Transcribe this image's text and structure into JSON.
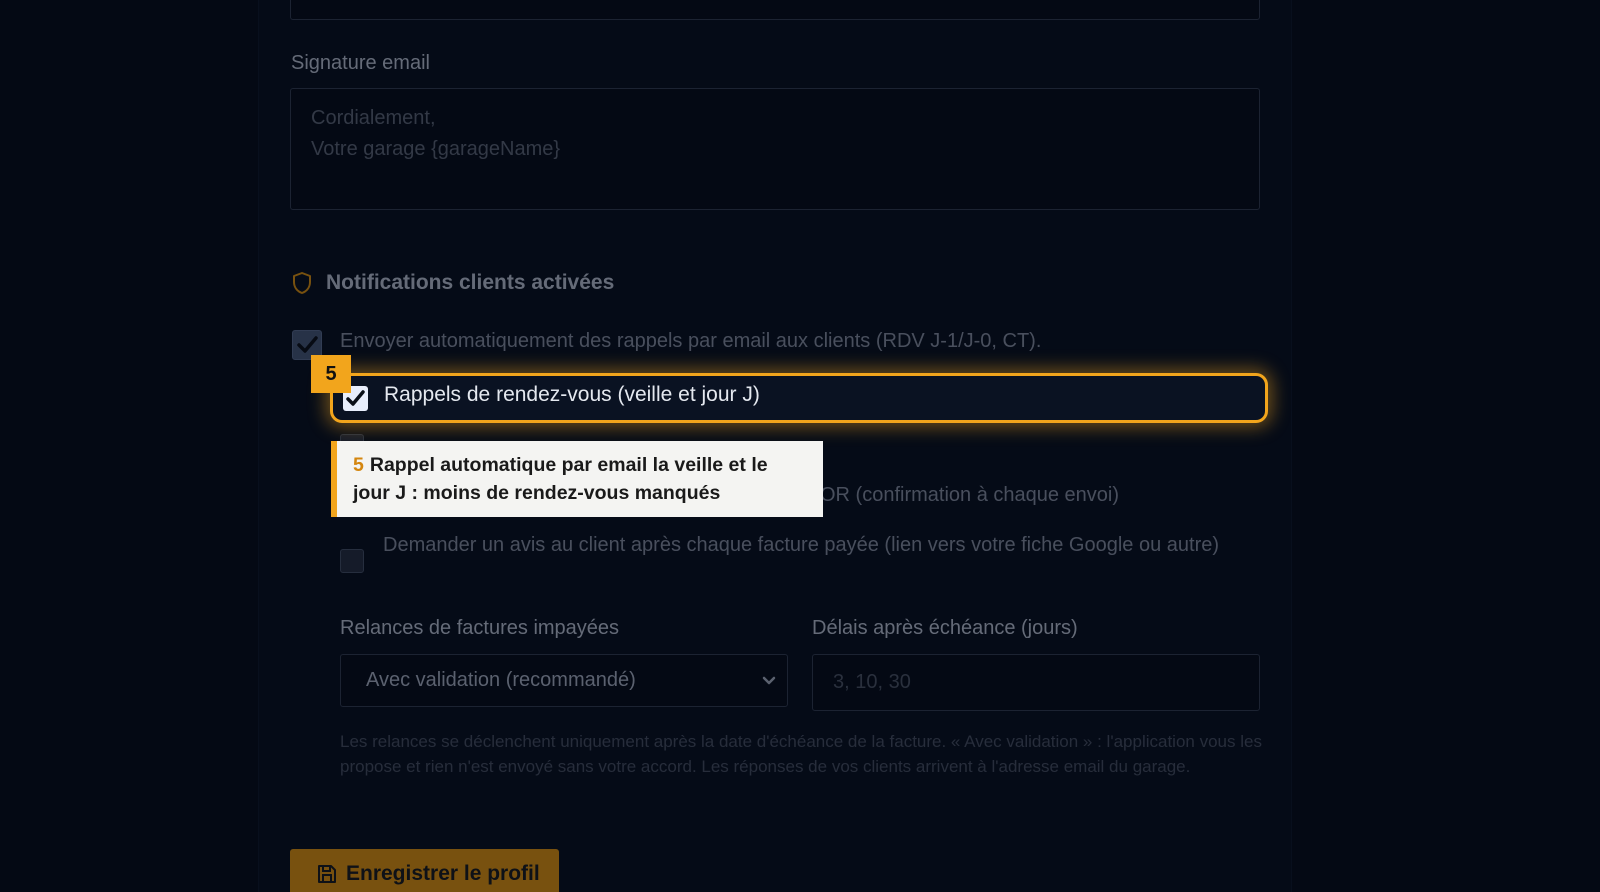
{
  "signature": {
    "label": "Signature email",
    "placeholder": "Cordialement,\nVotre garage {garageName}"
  },
  "notifications": {
    "title": "Notifications clients activées",
    "master": {
      "label": "Envoyer automatiquement des rappels par email aux clients (RDV J-1/J-0, CT).",
      "checked": true
    },
    "options": [
      {
        "label": "Rappels de rendez-vous (veille et jour J)",
        "checked": true
      },
      {
        "label": "OR (confirmation à chaque envoi)",
        "checked": false
      },
      {
        "label": "Demander un avis au client après chaque facture payée (lien vers votre fiche Google ou autre)",
        "checked": false
      }
    ]
  },
  "tutorial": {
    "step": "5",
    "text": "Rappel automatique par email la veille et le jour J : moins de rendez-vous manqués",
    "accent_color": "#f2a51c"
  },
  "reminders": {
    "label": "Relances de factures impayées",
    "selected": "Avec validation (recommandé)"
  },
  "delays": {
    "label": "Délais après échéance (jours)",
    "placeholder": "3, 10, 30"
  },
  "help_text": "Les relances se déclenchent uniquement après la date d'échéance de la facture. « Avec validation » : l'application vous les propose et rien n'est envoyé sans votre accord. Les réponses de vos clients arrivent à l'adresse email du garage.",
  "save_button": {
    "label": "Enregistrer le profil",
    "icon": "save-icon"
  }
}
